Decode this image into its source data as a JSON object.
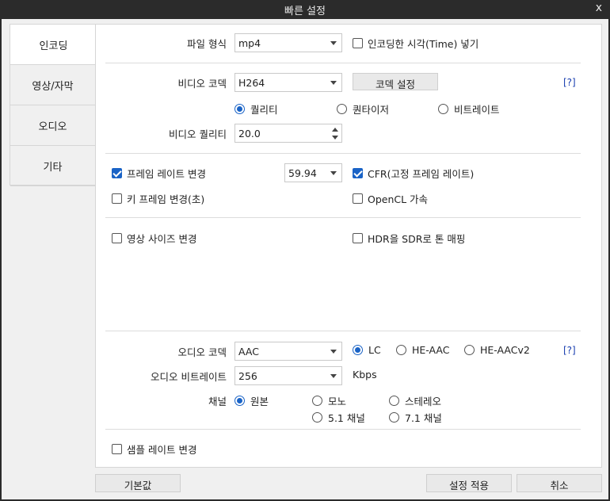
{
  "window": {
    "title": "빠른 설정",
    "close_label": "x"
  },
  "tabs": [
    {
      "label": "인코딩",
      "active": true
    },
    {
      "label": "영상/자막",
      "active": false
    },
    {
      "label": "오디오",
      "active": false
    },
    {
      "label": "기타",
      "active": false
    }
  ],
  "file_format": {
    "label": "파일 형식",
    "value": "mp4",
    "insert_time_label": "인코딩한 시각(Time) 넣기",
    "insert_time_checked": false
  },
  "video_codec": {
    "label": "비디오 코덱",
    "value": "H264",
    "settings_button": "코덱 설정",
    "help": "[?]"
  },
  "rate_control": {
    "options": [
      "퀄리티",
      "퀀타이저",
      "비트레이트"
    ],
    "selected": "퀄리티"
  },
  "video_quality": {
    "label": "비디오 퀄리티",
    "value": "20.0"
  },
  "frame_rate": {
    "label": "프레임 레이트 변경",
    "checked": true,
    "value": "59.94"
  },
  "cfr": {
    "label": "CFR(고정 프레임 레이트)",
    "checked": true
  },
  "keyframe": {
    "label": "키 프레임 변경(초)",
    "checked": false
  },
  "opencl": {
    "label": "OpenCL 가속",
    "checked": false
  },
  "resize": {
    "label": "영상 사이즈 변경",
    "checked": false
  },
  "hdr_tonemap": {
    "label": "HDR을 SDR로 톤 매핑",
    "checked": false
  },
  "audio_codec": {
    "label": "오디오 코덱",
    "value": "AAC",
    "profiles": [
      "LC",
      "HE-AAC",
      "HE-AACv2"
    ],
    "selected": "LC",
    "help": "[?]"
  },
  "audio_bitrate": {
    "label": "오디오 비트레이트",
    "value": "256",
    "unit": "Kbps"
  },
  "channel": {
    "label": "채널",
    "options": [
      "원본",
      "모노",
      "스테레오",
      "5.1 채널",
      "7.1 채널"
    ],
    "selected": "원본"
  },
  "sample_rate": {
    "label": "샘플 레이트 변경",
    "checked": false
  },
  "footer": {
    "default_button": "기본값",
    "apply_button": "설정 적용",
    "cancel_button": "취소"
  },
  "colors": {
    "accent": "#1a63c6",
    "titlebar": "#2b2b2b",
    "panel": "#ffffff",
    "window": "#f0f0f0"
  }
}
